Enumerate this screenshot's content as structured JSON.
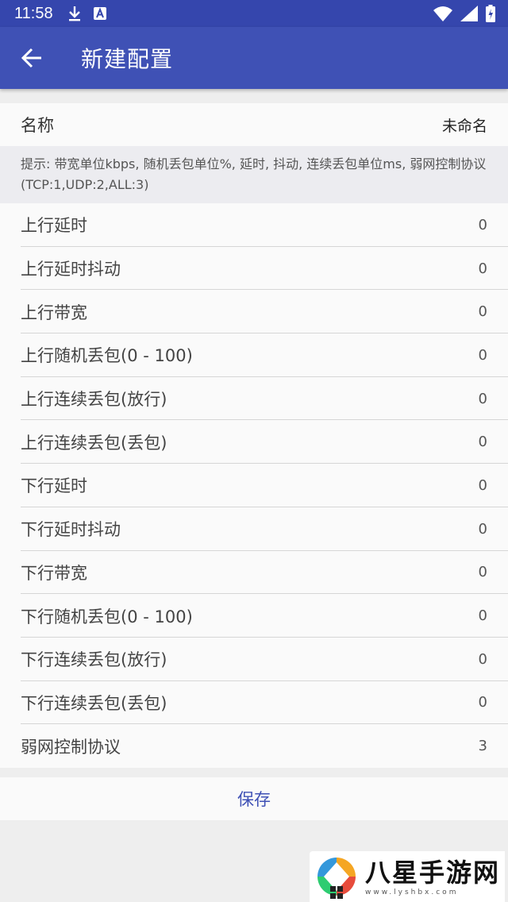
{
  "status_bar": {
    "time": "11:58"
  },
  "app_bar": {
    "title": "新建配置"
  },
  "name_row": {
    "label": "名称",
    "value": "未命名"
  },
  "hint": "提示: 带宽单位kbps, 随机丢包单位%, 延时, 抖动, 连续丢包单位ms, 弱网控制协议(TCP:1,UDP:2,ALL:3)",
  "rows": [
    {
      "label": "上行延时",
      "value": "0"
    },
    {
      "label": "上行延时抖动",
      "value": "0"
    },
    {
      "label": "上行带宽",
      "value": "0"
    },
    {
      "label": "上行随机丢包(0 - 100)",
      "value": "0"
    },
    {
      "label": "上行连续丢包(放行)",
      "value": "0"
    },
    {
      "label": "上行连续丢包(丢包)",
      "value": "0"
    },
    {
      "label": "下行延时",
      "value": "0"
    },
    {
      "label": "下行延时抖动",
      "value": "0"
    },
    {
      "label": "下行带宽",
      "value": "0"
    },
    {
      "label": "下行随机丢包(0 - 100)",
      "value": "0"
    },
    {
      "label": "下行连续丢包(放行)",
      "value": "0"
    },
    {
      "label": "下行连续丢包(丢包)",
      "value": "0"
    },
    {
      "label": "弱网控制协议",
      "value": "3"
    }
  ],
  "save_label": "保存",
  "watermark": {
    "main": "八星手游网",
    "sub": "www.lyshbx.com"
  },
  "colors": {
    "status_bar": "#3546ad",
    "app_bar": "#3f51b5",
    "accent": "#3f51b5"
  }
}
